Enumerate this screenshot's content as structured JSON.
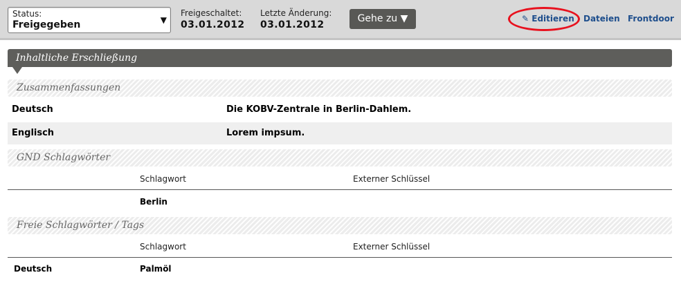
{
  "toolbar": {
    "status": {
      "label": "Status:",
      "value": "Freigegeben"
    },
    "freigeschaltet": {
      "label": "Freigeschaltet:",
      "value": "03.01.2012"
    },
    "letzte_aenderung": {
      "label": "Letzte Änderung:",
      "value": "03.01.2012"
    },
    "goto_label": "Gehe zu",
    "links": {
      "edit": "Editieren",
      "dateien": "Dateien",
      "frontdoor": "Frontdoor"
    },
    "icons": {
      "status_dropdown": "triangle-down-icon",
      "goto_dropdown": "triangle-down-icon",
      "edit": "pencil-icon"
    }
  },
  "section": {
    "title": "Inhaltliche Erschließung",
    "zusammenfassungen": {
      "title": "Zusammenfassungen",
      "rows": [
        {
          "lang": "Deutsch",
          "text": "Die KOBV-Zentrale in Berlin-Dahlem."
        },
        {
          "lang": "Englisch",
          "text": "Lorem impsum."
        }
      ]
    },
    "gnd": {
      "title": "GND Schlagwörter",
      "columns": [
        "Schlagwort",
        "Externer Schlüssel"
      ],
      "rows": [
        {
          "lang": "",
          "term": "Berlin"
        }
      ]
    },
    "freie": {
      "title": "Freie Schlagwörter / Tags",
      "columns": [
        "Schlagwort",
        "Externer Schlüssel"
      ],
      "rows": [
        {
          "lang": "Deutsch",
          "term": "Palmöl"
        }
      ]
    }
  },
  "colors": {
    "header_bg": "#5e5e5b",
    "link": "#1e4e8c",
    "highlight": "#e8111e",
    "toolbar_bg": "#d9d9d9"
  }
}
